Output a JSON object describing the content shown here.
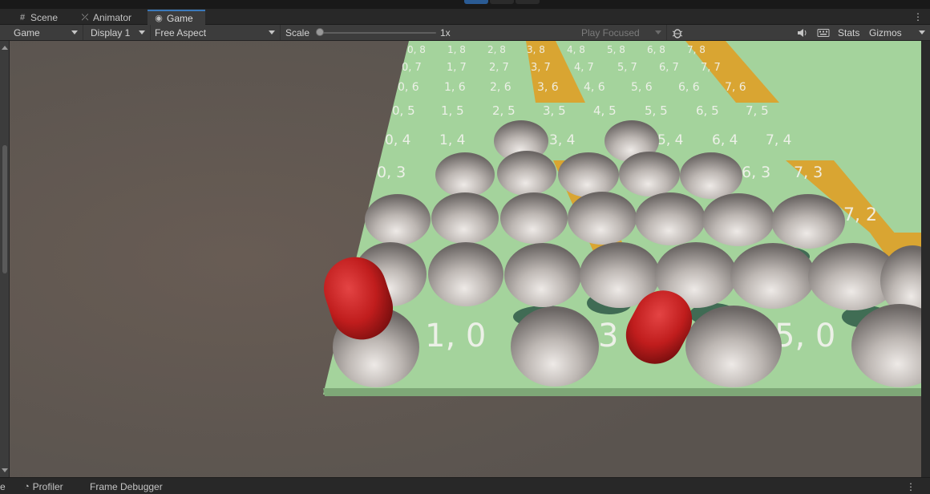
{
  "tabs": [
    {
      "label": "Scene",
      "icon": "grid-icon"
    },
    {
      "label": "Animator",
      "icon": "animator-icon"
    },
    {
      "label": "Game",
      "icon": "gamepad-icon"
    }
  ],
  "toolbar": {
    "display_mode": "Game",
    "display": "Display 1",
    "aspect": "Free Aspect",
    "scale_label": "Scale",
    "scale_value": "1x",
    "play_mode": "Play Focused",
    "stats_label": "Stats",
    "gizmos_label": "Gizmos"
  },
  "bottom_tabs": [
    {
      "label": "e"
    },
    {
      "label": "Profiler",
      "icon": "profiler-icon"
    },
    {
      "label": "Frame Debugger"
    }
  ],
  "grid_labels": {
    "row8": [
      "0, 8",
      "1, 8",
      "2, 8",
      "3, 8",
      "4, 8",
      "5, 8",
      "6, 8",
      "7, 8"
    ],
    "row7": [
      "0, 7",
      "1, 7",
      "2, 7",
      "3, 7",
      "4, 7",
      "5, 7",
      "6, 7",
      "7, 7"
    ],
    "row6": [
      "0, 6",
      "1, 6",
      "2, 6",
      "3, 6",
      "4, 6",
      "5, 6",
      "6, 6",
      "7, 6"
    ],
    "row5": [
      "0, 5",
      "1, 5",
      "2, 5",
      "3, 5",
      "4, 5",
      "5, 5",
      "6, 5",
      "7, 5"
    ],
    "row4": [
      "0, 4",
      "1, 4",
      "3, 4",
      "5, 4",
      "6, 4",
      "7, 4"
    ],
    "row3": [
      "0, 3",
      "6, 3",
      "7, 3"
    ],
    "row2": [
      "7, 2"
    ],
    "row0": [
      "1, 0",
      "3",
      "5, 0"
    ]
  },
  "colors": {
    "board": "#a3d39c",
    "highlight": "#d9a532",
    "sphere": "#c2bcb8",
    "capsule": "#cc2222",
    "background": "#5f5852"
  }
}
